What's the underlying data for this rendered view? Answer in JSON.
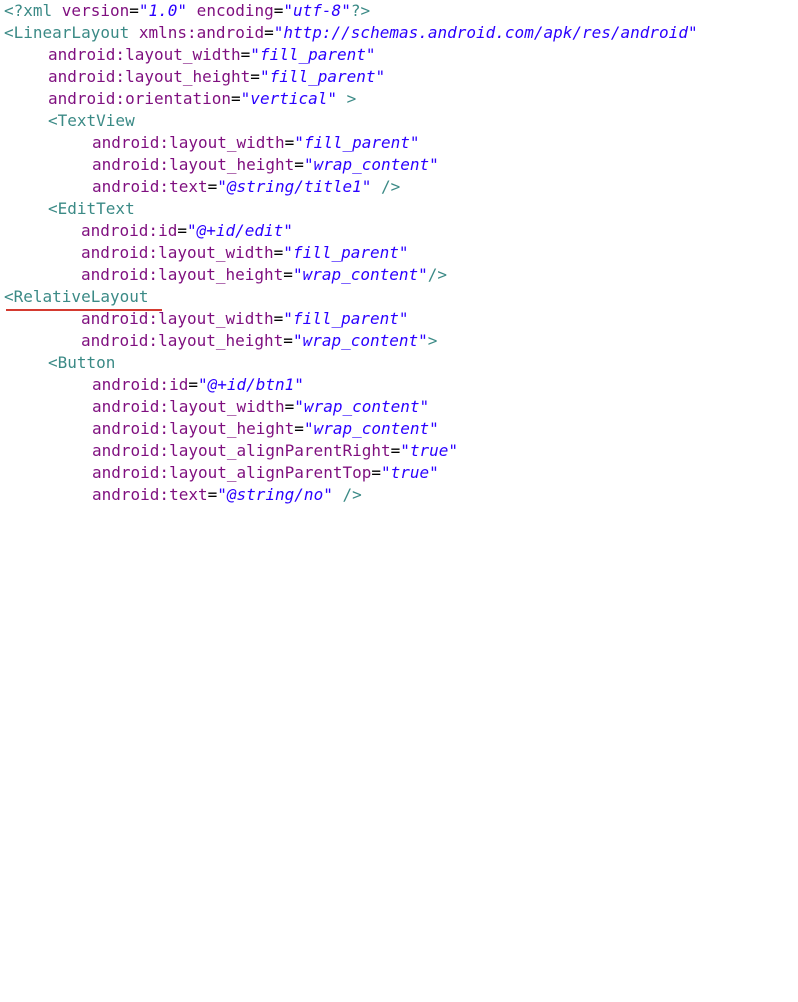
{
  "lines": [
    {
      "l1a": "<?xml ",
      "l1b": "version",
      "l1c": "=",
      "l1d": "\"1.0\"",
      "l1e": " encoding",
      "l1f": "=",
      "l1g": "\"utf-8\"",
      "l1h": "?>"
    },
    {
      "a": "<LinearLayout ",
      "b": "xmlns:android",
      "c": "=",
      "d": "\"http://schemas.android.com/apk/res/android\""
    },
    {
      "a": "android:layout_width",
      "b": "=",
      "c": "\"fill_parent\""
    },
    {
      "a": "android:layout_height",
      "b": "=",
      "c": "\"fill_parent\""
    },
    {
      "a": "android:orientation",
      "b": "=",
      "c": "\"vertical\"",
      "d": " >"
    },
    {
      "a": "<TextView"
    },
    {
      "a": "android:layout_width",
      "b": "=",
      "c": "\"fill_parent\""
    },
    {
      "a": "android:layout_height",
      "b": "=",
      "c": "\"wrap_content\""
    },
    {
      "a": "android:text",
      "b": "=",
      "c": "\"@string/title1\"",
      "d": " />"
    },
    {
      "a": "<EditText"
    },
    {
      "a": "android:id",
      "b": "=",
      "c": "\"@+id/edit\""
    },
    {
      "a": "android:layout_width",
      "b": "=",
      "c": "\"fill_parent\""
    },
    {
      "a": "android:layout_height",
      "b": "=",
      "c": "\"wrap_content\"",
      "d": "/>"
    },
    {
      "a": "<RelativeLayout"
    },
    {
      "a": "android:layout_width",
      "b": "=",
      "c": "\"fill_parent\""
    },
    {
      "a": "android:layout_height",
      "b": "=",
      "c": "\"wrap_content\"",
      "d": ">"
    },
    {
      "a": "<Button"
    },
    {
      "a": "android:id",
      "b": "=",
      "c": "\"@+id/btn1\""
    },
    {
      "a": "android:layout_width",
      "b": "=",
      "c": "\"wrap_content\""
    },
    {
      "a": "android:layout_height",
      "b": "=",
      "c": "\"wrap_content\""
    },
    {
      "a": "android:layout_alignParentRight",
      "b": "=",
      "c": "\"true\""
    },
    {
      "a": "android:layout_alignParentTop",
      "b": "=",
      "c": "\"true\""
    },
    {
      "a": "android:text",
      "b": "=",
      "c": "\"@string/no\"",
      "d": " />"
    }
  ],
  "colors": {
    "tag": "#3b8a86",
    "attribute": "#7f0f7f",
    "string": "#2a00ff",
    "error_underline": "#d43a30"
  }
}
